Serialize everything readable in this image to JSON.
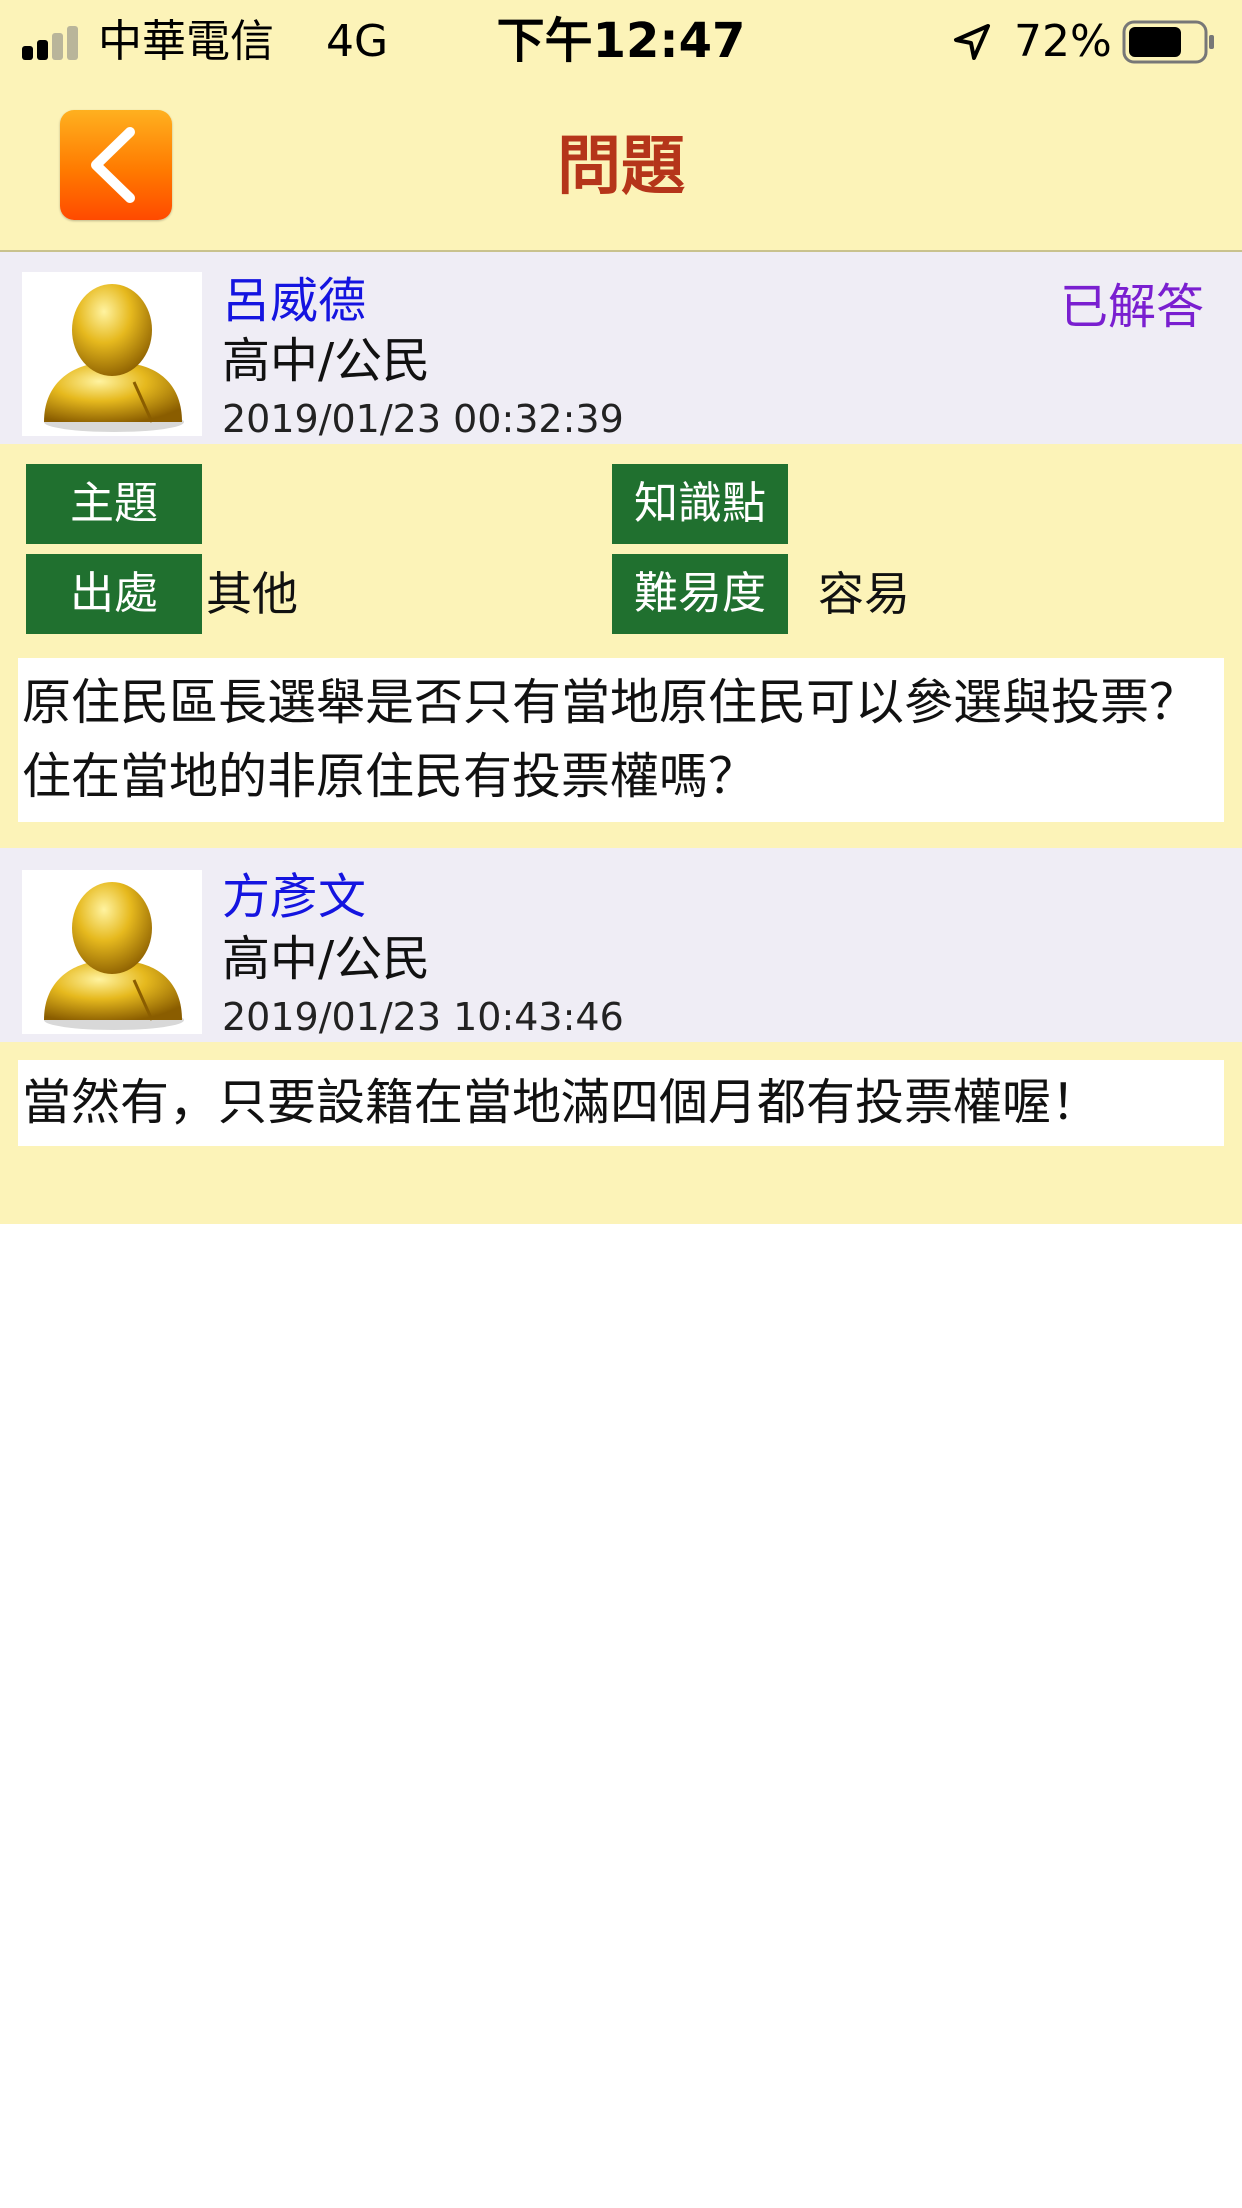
{
  "status_bar": {
    "carrier": "中華電信",
    "network": "4G",
    "time": "下午12:47",
    "battery": "72%",
    "battery_level": 0.72,
    "signal_bars": 2,
    "icons": [
      "signal-icon",
      "location-arrow-icon",
      "battery-icon"
    ]
  },
  "nav": {
    "title": "問題",
    "back_icon": "chevron-left-icon",
    "back_color": "#ff7a00"
  },
  "question": {
    "author": "呂威德",
    "subject": "高中/公民",
    "timestamp": "2019/01/23 00:32:39",
    "status": "已解答",
    "tags": {
      "topic_label": "主題",
      "topic_value": "",
      "knowledge_label": "知識點",
      "knowledge_value": "",
      "source_label": "出處",
      "source_value": "其他",
      "difficulty_label": "難易度",
      "difficulty_value": "容易"
    },
    "content": "原住民區長選舉是否只有當地原住民可以參選與投票？住在當地的非原住民有投票權嗎？"
  },
  "answer": {
    "author": "方彥文",
    "subject": "高中/公民",
    "timestamp": "2019/01/23 10:43:46",
    "content": "當然有，只要設籍在當地滿四個月都有投票權喔！"
  },
  "colors": {
    "header_bg": "#fcf3b8",
    "author_name": "#1414e0",
    "title": "#b5351a",
    "status": "#7a1fd0",
    "tag_bg": "#20702f",
    "user_header_bg": "#efedf5"
  }
}
